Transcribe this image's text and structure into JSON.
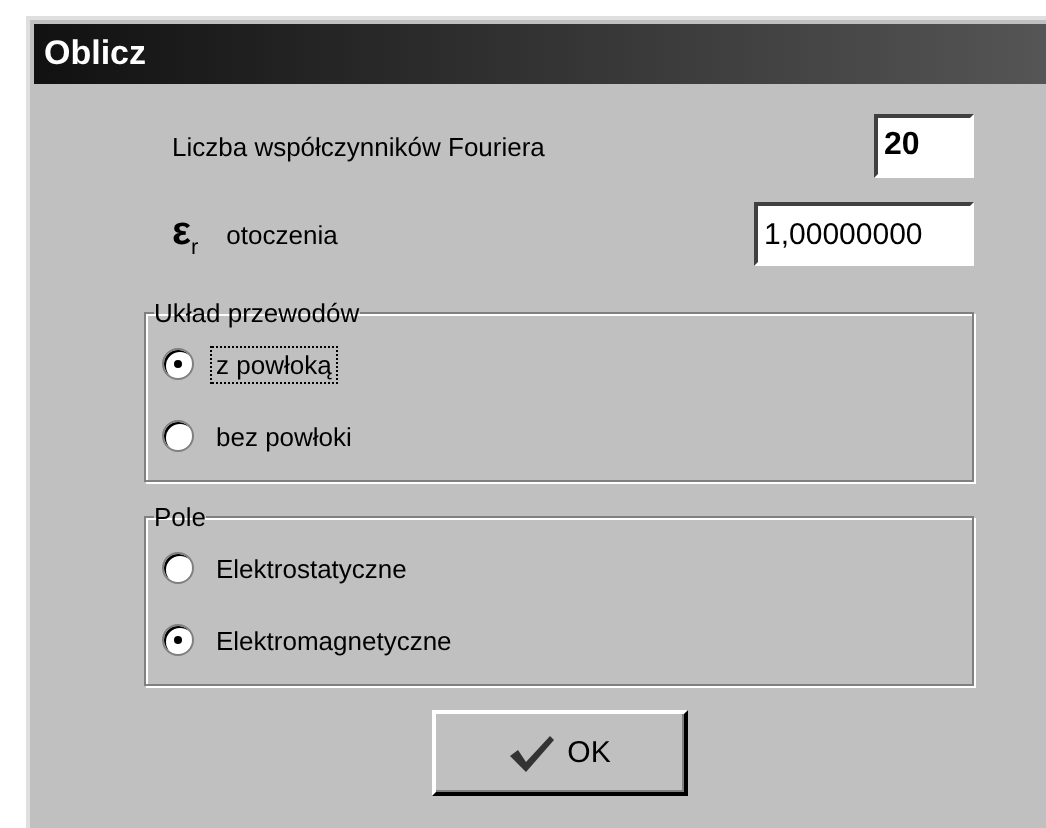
{
  "window": {
    "title": "Oblicz"
  },
  "fields": [
    {
      "label": "Liczba współczynników Fouriera",
      "value": "20",
      "bold": true
    },
    {
      "symbol": "ε$_{r}$",
      "label": "otoczenia",
      "value": "1,00000000",
      "bold": false
    }
  ],
  "groups": [
    {
      "title": "Układ przewodów",
      "options": [
        {
          "label": "z powłoką",
          "selected": true,
          "focused": true
        },
        {
          "label": "bez powłoki",
          "selected": false,
          "focused": false
        }
      ]
    },
    {
      "title": "Pole",
      "options": [
        {
          "label": "Elektrostatyczne",
          "selected": false,
          "focused": false
        },
        {
          "label": "Elektromagnetyczne",
          "selected": true,
          "focused": false
        }
      ]
    }
  ],
  "button": {
    "label": "OK"
  }
}
